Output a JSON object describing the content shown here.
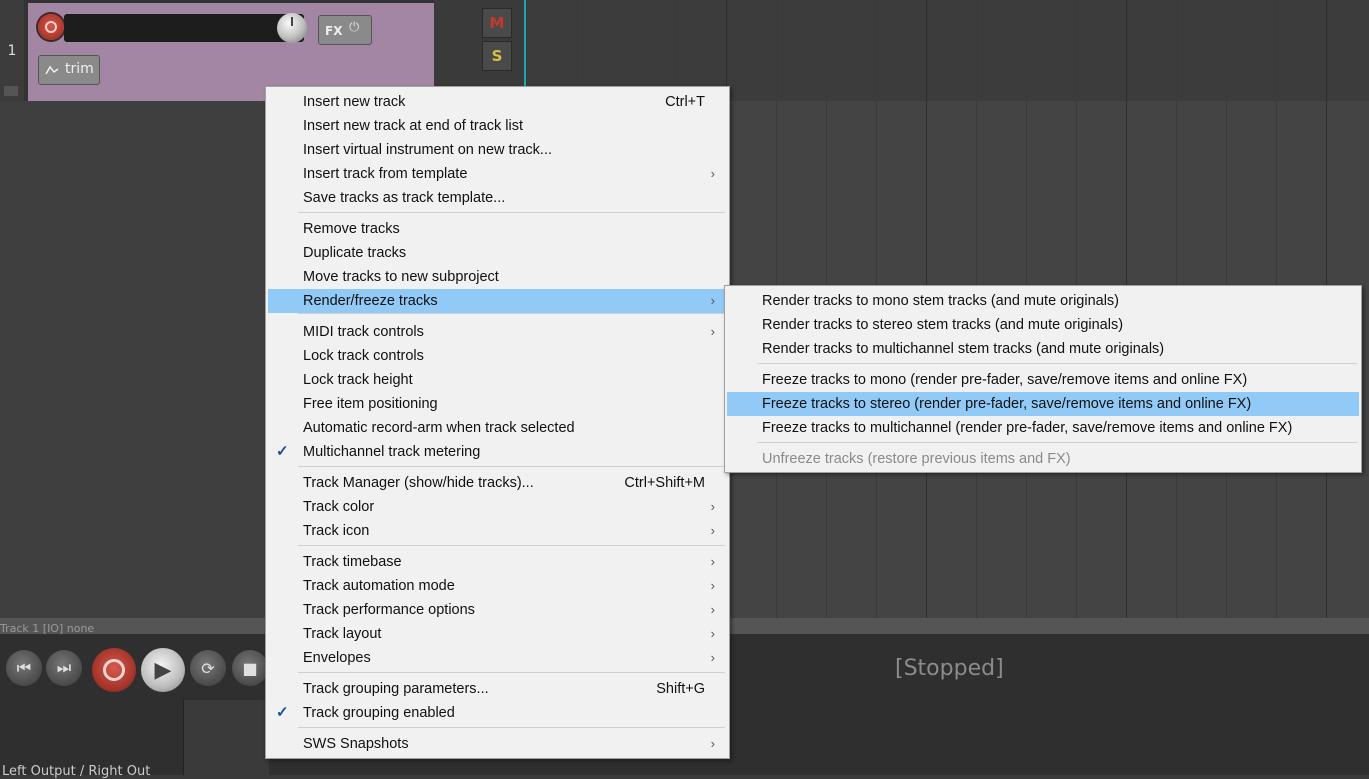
{
  "track": {
    "number": "1",
    "fx_label": "FX",
    "trim_label": "trim",
    "mute_label": "M",
    "solo_label": "S",
    "color": "#a386a4"
  },
  "transport": {
    "track_info": "Track 1 [IO] none",
    "status": "[Stopped]",
    "output_label": "Left Output / Right Out"
  },
  "context_menu": {
    "items": [
      {
        "label": "Insert new track",
        "shortcut": "Ctrl+T"
      },
      {
        "label": "Insert new track at end of track list"
      },
      {
        "label": "Insert virtual instrument on new track..."
      },
      {
        "label": "Insert track from template",
        "submenu": true
      },
      {
        "label": "Save tracks as track template..."
      },
      {
        "label": "Remove tracks"
      },
      {
        "label": "Duplicate tracks"
      },
      {
        "label": "Move tracks to new subproject"
      },
      {
        "label": "Render/freeze tracks",
        "submenu": true,
        "highlighted": true
      },
      {
        "label": "MIDI track controls",
        "submenu": true
      },
      {
        "label": "Lock track controls"
      },
      {
        "label": "Lock track height"
      },
      {
        "label": "Free item positioning"
      },
      {
        "label": "Automatic record-arm when track selected"
      },
      {
        "label": "Multichannel track metering",
        "checked": true
      },
      {
        "label": "Track Manager (show/hide tracks)...",
        "shortcut": "Ctrl+Shift+M"
      },
      {
        "label": "Track color",
        "submenu": true
      },
      {
        "label": "Track icon",
        "submenu": true
      },
      {
        "label": "Track timebase",
        "submenu": true
      },
      {
        "label": "Track automation mode",
        "submenu": true
      },
      {
        "label": "Track performance options",
        "submenu": true
      },
      {
        "label": "Track layout",
        "submenu": true
      },
      {
        "label": "Envelopes",
        "submenu": true
      },
      {
        "label": "Track grouping parameters...",
        "shortcut": "Shift+G"
      },
      {
        "label": "Track grouping enabled",
        "checked": true
      },
      {
        "label": "SWS Snapshots",
        "submenu": true
      }
    ]
  },
  "render_submenu": {
    "items": [
      {
        "label": "Render tracks to mono stem tracks (and mute originals)"
      },
      {
        "label": "Render tracks to stereo stem tracks (and mute originals)"
      },
      {
        "label": "Render tracks to multichannel stem tracks (and mute originals)"
      },
      {
        "label": "Freeze tracks to mono (render pre-fader, save/remove items and online FX)"
      },
      {
        "label": "Freeze tracks to stereo (render pre-fader, save/remove items and online FX)",
        "highlighted": true
      },
      {
        "label": "Freeze tracks to multichannel (render pre-fader, save/remove items and online FX)"
      },
      {
        "label": "Unfreeze tracks (restore previous items and FX)",
        "disabled": true
      }
    ]
  },
  "colors": {
    "menu_highlight": "#91c9f7",
    "record": "#b23a2f",
    "cursor": "#1fa7b0"
  },
  "icons": {
    "check": "✓",
    "submenu_arrow": "›"
  }
}
